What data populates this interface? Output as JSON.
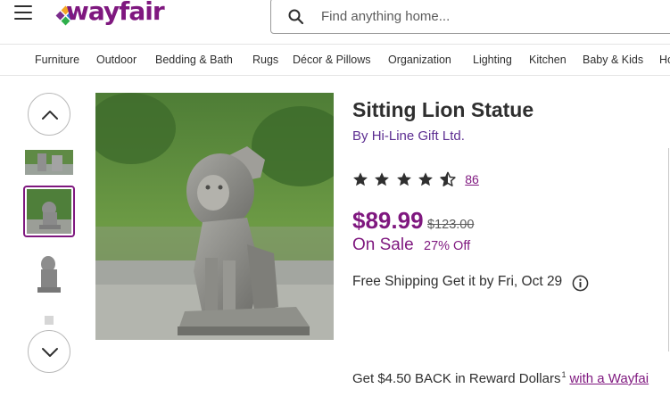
{
  "header": {
    "logo_text": "wayfair",
    "search_placeholder": "Find anything home...",
    "brand_color": "#7f187f"
  },
  "nav": {
    "items": [
      "Furniture",
      "Outdoor",
      "Bedding & Bath",
      "Rugs",
      "Décor & Pillows",
      "Organization",
      "Lighting",
      "Kitchen",
      "Baby & Kids",
      "Ho"
    ]
  },
  "gallery": {
    "thumb_count_visible": 4,
    "selected_index": 1
  },
  "product": {
    "title": "Sitting Lion Statue",
    "by_prefix": "By",
    "brand": "Hi-Line Gift Ltd.",
    "rating_stars": 4.5,
    "review_count": "86",
    "price": "$89.99",
    "list_price": "$123.00",
    "sale_label": "On Sale",
    "discount": "27% Off",
    "shipping": "Free Shipping Get it by Fri, Oct 29",
    "reward_text": "Get $4.50 BACK in Reward Dollars",
    "reward_footnote": "1",
    "reward_link": "with a Wayfai"
  }
}
